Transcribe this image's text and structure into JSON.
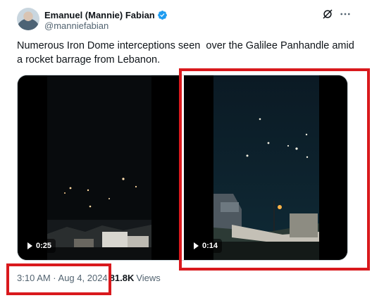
{
  "author": {
    "name": "Emanuel (Mannie) Fabian",
    "handle": "@manniefabian",
    "verified": true
  },
  "post": {
    "text": "Numerous Iron Dome interceptions seen  over the Galilee Panhandle amid a rocket barrage from Lebanon."
  },
  "media": {
    "videos": [
      {
        "duration": "0:25"
      },
      {
        "duration": "0:14"
      }
    ]
  },
  "meta": {
    "timestamp": "3:10 AM · Aug 4, 2024",
    "separator": "·",
    "views_count": "81.8K",
    "views_label": "Views"
  },
  "icons": {
    "verified": "verified-badge-icon",
    "grok": "grok-icon",
    "more": "more-options-icon",
    "play": "play-icon"
  },
  "colors": {
    "verified_blue": "#1d9bf0",
    "secondary_text": "#536471",
    "annotation_red": "#d9191d"
  }
}
